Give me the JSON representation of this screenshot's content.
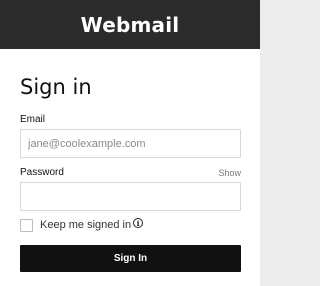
{
  "header": {
    "title": "Webmail"
  },
  "form": {
    "heading": "Sign in",
    "email": {
      "label": "Email",
      "value": "",
      "placeholder": "jane@coolexample.com"
    },
    "password": {
      "label": "Password",
      "value": "",
      "placeholder": "",
      "show_label": "Show"
    },
    "remember": {
      "label": "Keep me signed in",
      "checked": false,
      "info_icon": "info-icon",
      "info_glyph": "i"
    },
    "submit_label": "Sign In"
  },
  "colors": {
    "header_bg": "#2b2b2b",
    "button_bg": "#111111",
    "page_bg": "#ececec",
    "input_border": "#d8d8d8"
  }
}
